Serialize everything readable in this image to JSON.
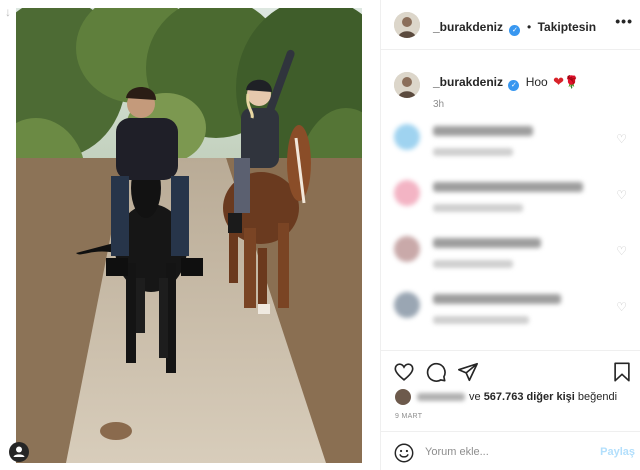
{
  "photo": {
    "description_icon": "arrow-down-icon",
    "tag_icon": "user-tag-icon"
  },
  "header": {
    "username": "_burakdeniz",
    "verified_icon": "verified-badge-icon",
    "separator": "•",
    "follow_status": "Takiptesin",
    "more_icon": "more-options-icon",
    "more_label": "•••"
  },
  "caption": {
    "username": "_burakdeniz",
    "text": "Hoo",
    "emojis": [
      "heart",
      "rose"
    ],
    "heart_glyph": "❤",
    "rose_glyph": "🌹",
    "time": "3h"
  },
  "comments": [
    {
      "avatar_color": "#9fd3f0",
      "status": "blurred"
    },
    {
      "avatar_color": "#f3b4c4",
      "status": "blurred"
    },
    {
      "avatar_color": "#c9a9a9",
      "status": "blurred"
    },
    {
      "avatar_color": "#9aa6b3",
      "status": "blurred"
    }
  ],
  "actions": {
    "like_icon": "heart-outline-icon",
    "comment_icon": "comment-bubble-icon",
    "share_icon": "paper-plane-icon",
    "save_icon": "bookmark-icon"
  },
  "likes": {
    "connector": "ve",
    "count": "567.763",
    "suffix": "diğer kişi",
    "verb": "beğendi"
  },
  "date": "9 MART",
  "add_comment": {
    "emoji_icon": "smiley-icon",
    "placeholder": "Yorum ekle...",
    "post_label": "Paylaş"
  },
  "colors": {
    "verified": "#3897f0",
    "post_button_disabled": "#b2dffc",
    "meta_text": "#8e8e8e"
  }
}
